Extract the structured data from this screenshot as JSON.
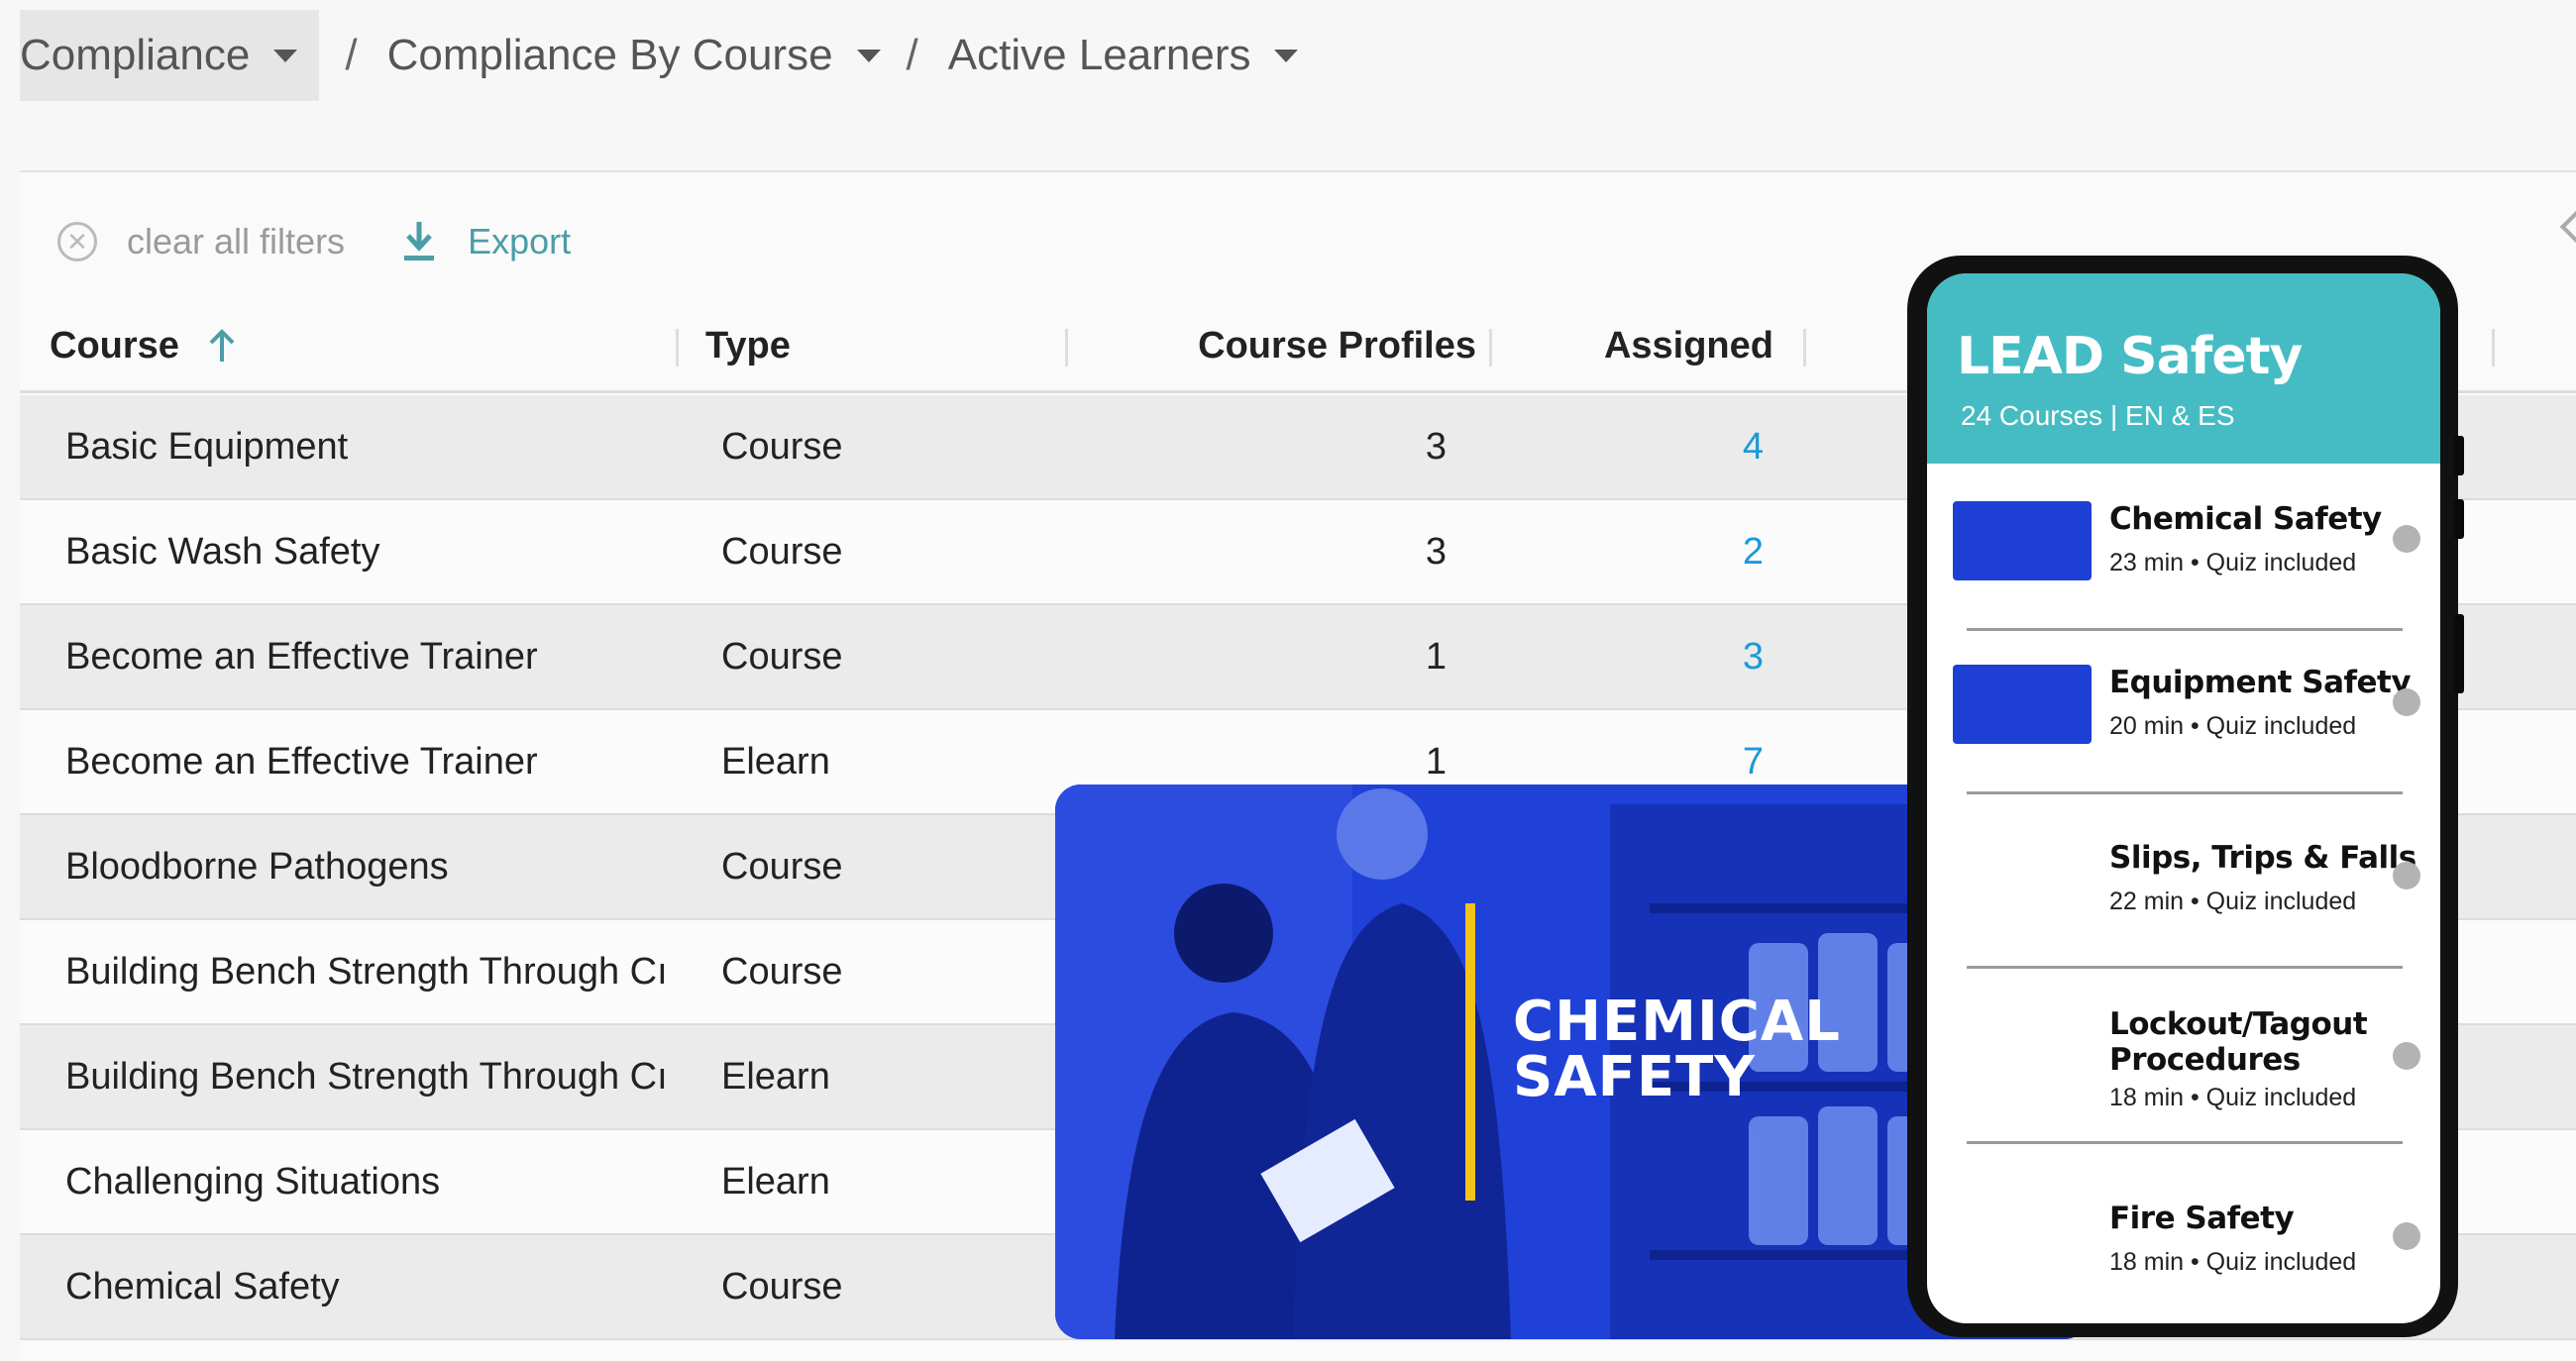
{
  "breadcrumb": [
    {
      "label": "Compliance"
    },
    {
      "label": "Compliance By Course"
    },
    {
      "label": "Active Learners"
    }
  ],
  "toolbar": {
    "clear_label": "clear all filters",
    "export_label": "Export"
  },
  "table": {
    "columns": [
      "Course",
      "Type",
      "Course Profiles",
      "Assigned"
    ],
    "rows": [
      {
        "course": "Basic Equipment",
        "type": "Course",
        "profiles": "3",
        "assigned": "4"
      },
      {
        "course": "Basic Wash Safety",
        "type": "Course",
        "profiles": "3",
        "assigned": "2"
      },
      {
        "course": "Become an Effective Trainer",
        "type": "Course",
        "profiles": "1",
        "assigned": "3"
      },
      {
        "course": "Become an Effective Trainer",
        "type": "Elearn",
        "profiles": "1",
        "assigned": "7"
      },
      {
        "course": "Bloodborne Pathogens",
        "type": "Course",
        "profiles": "",
        "assigned": ""
      },
      {
        "course": "Building Bench Strength Through Cı",
        "type": "Course",
        "profiles": "",
        "assigned": ""
      },
      {
        "course": "Building Bench Strength Through Cı",
        "type": "Elearn",
        "profiles": "",
        "assigned": ""
      },
      {
        "course": "Challenging Situations",
        "type": "Elearn",
        "profiles": "",
        "assigned": ""
      },
      {
        "course": "Chemical Safety",
        "type": "Course",
        "profiles": "",
        "assigned": ""
      }
    ]
  },
  "hero": {
    "title_line1": "CHEMICAL",
    "title_line2": "SAFETY"
  },
  "phone": {
    "title": "LEAD Safety",
    "subtitle": "24 Courses | EN & ES",
    "courses": [
      {
        "name": "Chemical Safety",
        "meta": "23 min • Quiz included"
      },
      {
        "name": "Equipment Safety",
        "meta": "20 min • Quiz included"
      },
      {
        "name": "Slips, Trips & Falls",
        "meta": "22 min • Quiz included"
      },
      {
        "name": "Lockout/Tagout Procedures",
        "meta": "18 min • Quiz included"
      },
      {
        "name": "Fire Safety",
        "meta": "18 min • Quiz included"
      }
    ]
  },
  "colors": {
    "accent_teal": "#45bcc3",
    "link_blue": "#1a9ad6",
    "hero_blue": "#1e3fd4",
    "hero_bar": "#f2c318"
  }
}
